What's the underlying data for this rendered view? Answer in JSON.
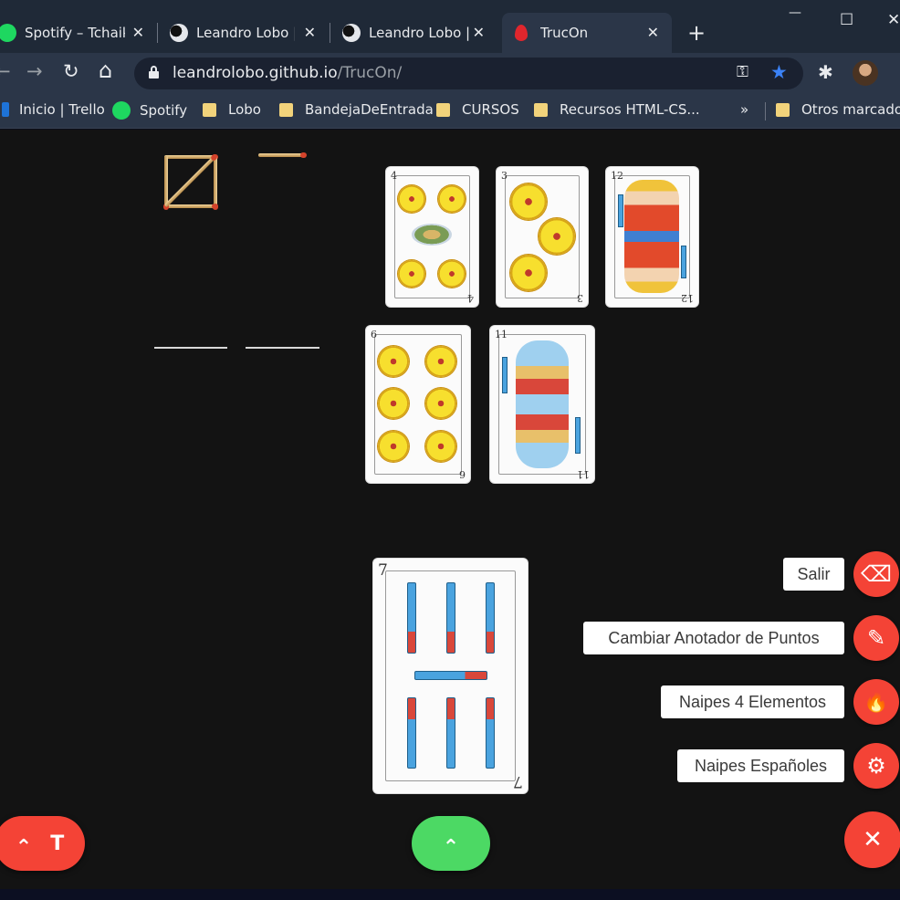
{
  "browser": {
    "tabs": [
      {
        "title": "Spotify – Tchaikovsky",
        "icon": "spotify-icon",
        "close": "✕"
      },
      {
        "title": "Leandro Lobo | Web Developer",
        "icon": "leandro-lobo-favicon",
        "close": "✕"
      },
      {
        "title": "Leandro Lobo | Artículos",
        "icon": "leandro-lobo-favicon",
        "close": "✕"
      },
      {
        "title": "TrucOn",
        "icon": "trucon-flame-favicon",
        "close": "✕"
      }
    ],
    "new_tab": "+",
    "window_controls": {
      "minimize": "—",
      "maximize": "☐",
      "close": "✕"
    },
    "toolbar": {
      "back": "←",
      "forward": "→",
      "reload": "↻",
      "home": "⌂",
      "extensions": "✱",
      "menu": "⋮"
    },
    "url": {
      "host": "leandrolobo.github.io",
      "path": "/TrucOn/",
      "key_icon": "⚿",
      "star_icon": "★"
    },
    "bookmarks": [
      {
        "label": "Inicio | Trello",
        "icon": "trello-icon"
      },
      {
        "label": "Spotify",
        "icon": "spotify-icon"
      },
      {
        "label": "Lobo",
        "icon": "folder-icon"
      },
      {
        "label": "BandejaDeEntrada",
        "icon": "folder-icon"
      },
      {
        "label": "CURSOS",
        "icon": "folder-icon"
      },
      {
        "label": "Recursos HTML-CS...",
        "icon": "folder-icon"
      }
    ],
    "bookmarks_overflow": "»",
    "other_bookmarks": "Otros marcadores"
  },
  "game": {
    "table_cards": [
      {
        "number": "4",
        "suit": "oros"
      },
      {
        "number": "3",
        "suit": "oros"
      },
      {
        "number": "12",
        "suit": "espadas"
      },
      {
        "number": "6",
        "suit": "oros"
      },
      {
        "number": "11",
        "suit": "espadas"
      }
    ],
    "hand_card": {
      "number": "7",
      "suit": "espadas"
    }
  },
  "menu": {
    "items": [
      {
        "label": "Salir",
        "icon": "backspace-icon",
        "glyph": "⌫"
      },
      {
        "label": "Cambiar Anotador de Puntos",
        "icon": "pencil-icon",
        "glyph": "✎"
      },
      {
        "label": "Naipes 4 Elementos",
        "icon": "fire-icon",
        "glyph": "🔥"
      },
      {
        "label": "Naipes Españoles",
        "icon": "gear-icon",
        "glyph": "⚙"
      }
    ],
    "close_glyph": "✕"
  },
  "fabs": {
    "left": {
      "glyph_up": "⌃",
      "glyph_t": "T"
    },
    "center": {
      "glyph": "⌃"
    }
  },
  "colors": {
    "accent_red": "#f44336",
    "accent_green": "#4cd964",
    "tab_bar": "#1f2937",
    "toolbar": "#2b3648",
    "page_bg": "#131313"
  }
}
